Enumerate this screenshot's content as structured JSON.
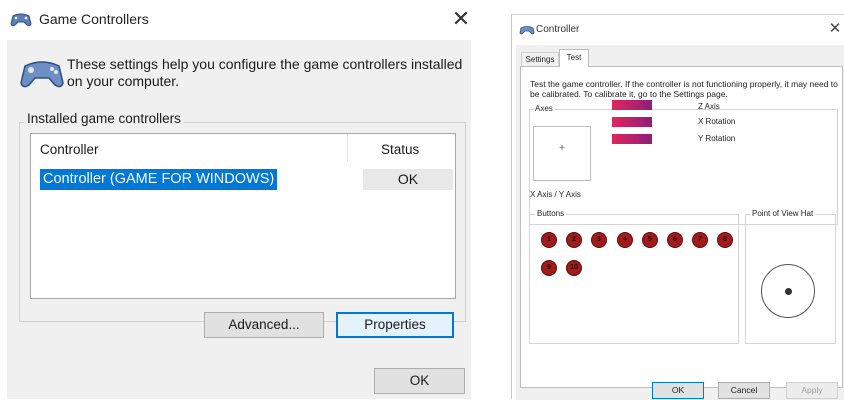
{
  "game_controllers": {
    "title": "Game Controllers",
    "close_glyph": "✕",
    "description": "These settings help you configure the game controllers installed on your computer.",
    "group_label": "Installed game controllers",
    "columns": {
      "controller": "Controller",
      "status": "Status"
    },
    "rows": [
      {
        "name": "Controller (GAME FOR WINDOWS)",
        "status": "OK"
      }
    ],
    "buttons": {
      "advanced": "Advanced...",
      "properties": "Properties",
      "ok": "OK"
    },
    "icon": "gamepad-icon",
    "selection_color": "#0078d7"
  },
  "controller": {
    "title": "Controller",
    "close_glyph": "✕",
    "tabs": [
      "Settings",
      "Test"
    ],
    "active_tab": "Test",
    "description": "Test the game controller.  If the controller is not functioning properly, it may need to be calibrated.  To calibrate it, go to the Settings page.",
    "axes": {
      "label": "Axes",
      "xy_label": "X Axis / Y Axis",
      "items": [
        {
          "label": "Z Axis"
        },
        {
          "label": "X Rotation"
        },
        {
          "label": "Y Rotation"
        }
      ]
    },
    "buttons_group": {
      "label": "Buttons",
      "items": [
        "1",
        "2",
        "3",
        "4",
        "5",
        "6",
        "7",
        "8",
        "9",
        "10"
      ]
    },
    "pov": {
      "label": "Point of View Hat"
    },
    "footer": {
      "ok": "OK",
      "cancel": "Cancel",
      "apply": "Apply"
    },
    "bar_colors": [
      "#e0265c",
      "#8e1f7a"
    ],
    "button_dot_color": "#a11b1b"
  }
}
